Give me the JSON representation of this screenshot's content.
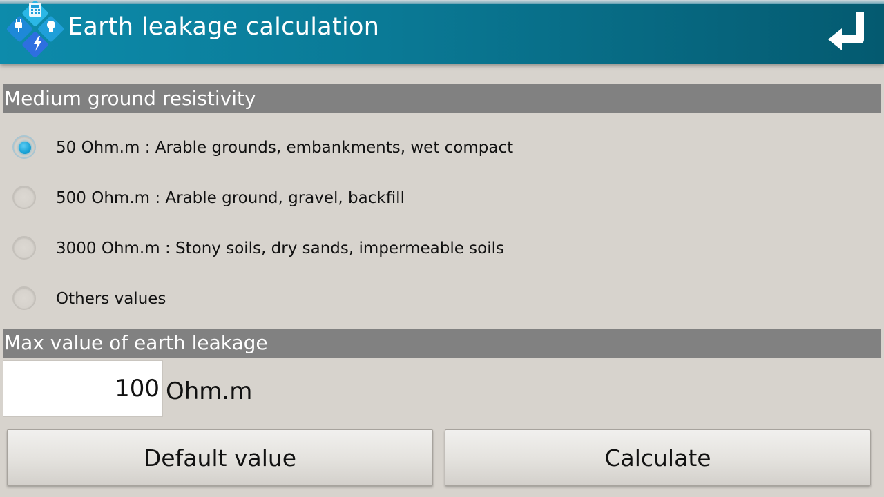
{
  "header": {
    "title": "Earth leakage calculation",
    "logo_icon": "electric-calculator-logo-icon",
    "back_icon": "return-arrow-icon"
  },
  "resistivity_section": {
    "heading": "Medium ground resistivity",
    "selected_index": 0,
    "options": [
      {
        "label": "50 Ohm.m : Arable grounds, embankments, wet compact"
      },
      {
        "label": "500 Ohm.m : Arable ground, gravel, backfill"
      },
      {
        "label": "3000 Ohm.m : Stony soils, dry sands, impermeable soils"
      },
      {
        "label": "Others values"
      }
    ]
  },
  "leakage_section": {
    "heading": "Max value of earth leakage",
    "value": "100",
    "unit": "Ohm.m"
  },
  "buttons": {
    "default_label": "Default value",
    "calculate_label": "Calculate"
  },
  "colors": {
    "titlebar": "#0a7995",
    "section_header": "#818181",
    "background": "#d7d3cd",
    "radio_accent": "#1aa3d6"
  }
}
